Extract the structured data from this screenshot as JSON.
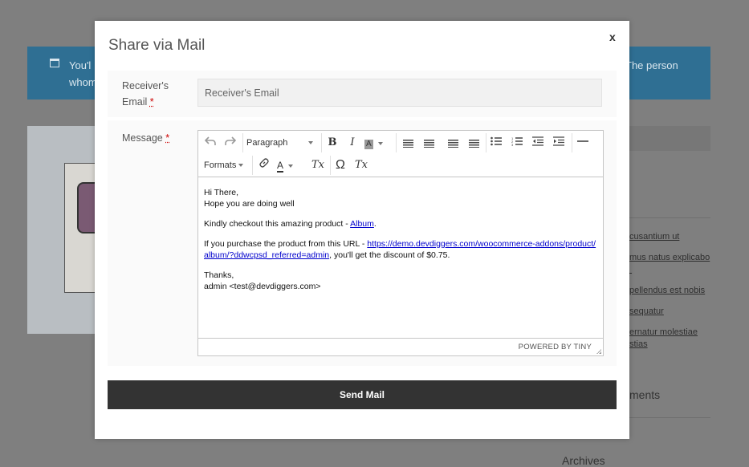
{
  "background": {
    "notice_line1": "You'l",
    "notice_line2": "whom",
    "notice_line3": "The person",
    "sidebar_links": [
      "cusantium ut",
      "mus natus explicabo",
      "",
      "pellendus est nobis",
      "sequatur",
      "ernatur molestiae",
      "stias"
    ],
    "comments_heading": "ments",
    "archives_heading": "Archives"
  },
  "modal": {
    "title": "Share via Mail",
    "close_label": "x",
    "receiver_label": "Receiver's Email",
    "required_mark": "*",
    "receiver_placeholder": "Receiver's Email",
    "message_label": "Message",
    "toolbar": {
      "undo_icon": "undo-icon",
      "redo_icon": "redo-icon",
      "block_format": "Paragraph",
      "bold": "B",
      "italic": "I",
      "background_color": "A",
      "formats": "Formats",
      "text_color": "A",
      "clear_format": "Tx",
      "special_char": "Ω",
      "remove_format": "Tx"
    },
    "message": {
      "greeting": "Hi There,",
      "line2": "Hope you are doing well",
      "checkout_text": "Kindly checkout this amazing product - ",
      "product_link": "Album",
      "purchase_text": "If you purchase the product from this URL - ",
      "purchase_link": "https://demo.devdiggers.com/woocommerce-addons/product/album/?ddwcpsd_referred=admin",
      "discount_text": ", you'll get the discount of $0.75.",
      "thanks": "Thanks,",
      "signature": "admin <test@devdiggers.com>"
    },
    "powered_by": "POWERED BY TINY",
    "send_label": "Send Mail"
  },
  "colors": {
    "overlay": "#7f7f7f",
    "notice": "#2f6f93",
    "send_button": "#333333",
    "link": "#0000cc",
    "required": "#cc0000"
  }
}
